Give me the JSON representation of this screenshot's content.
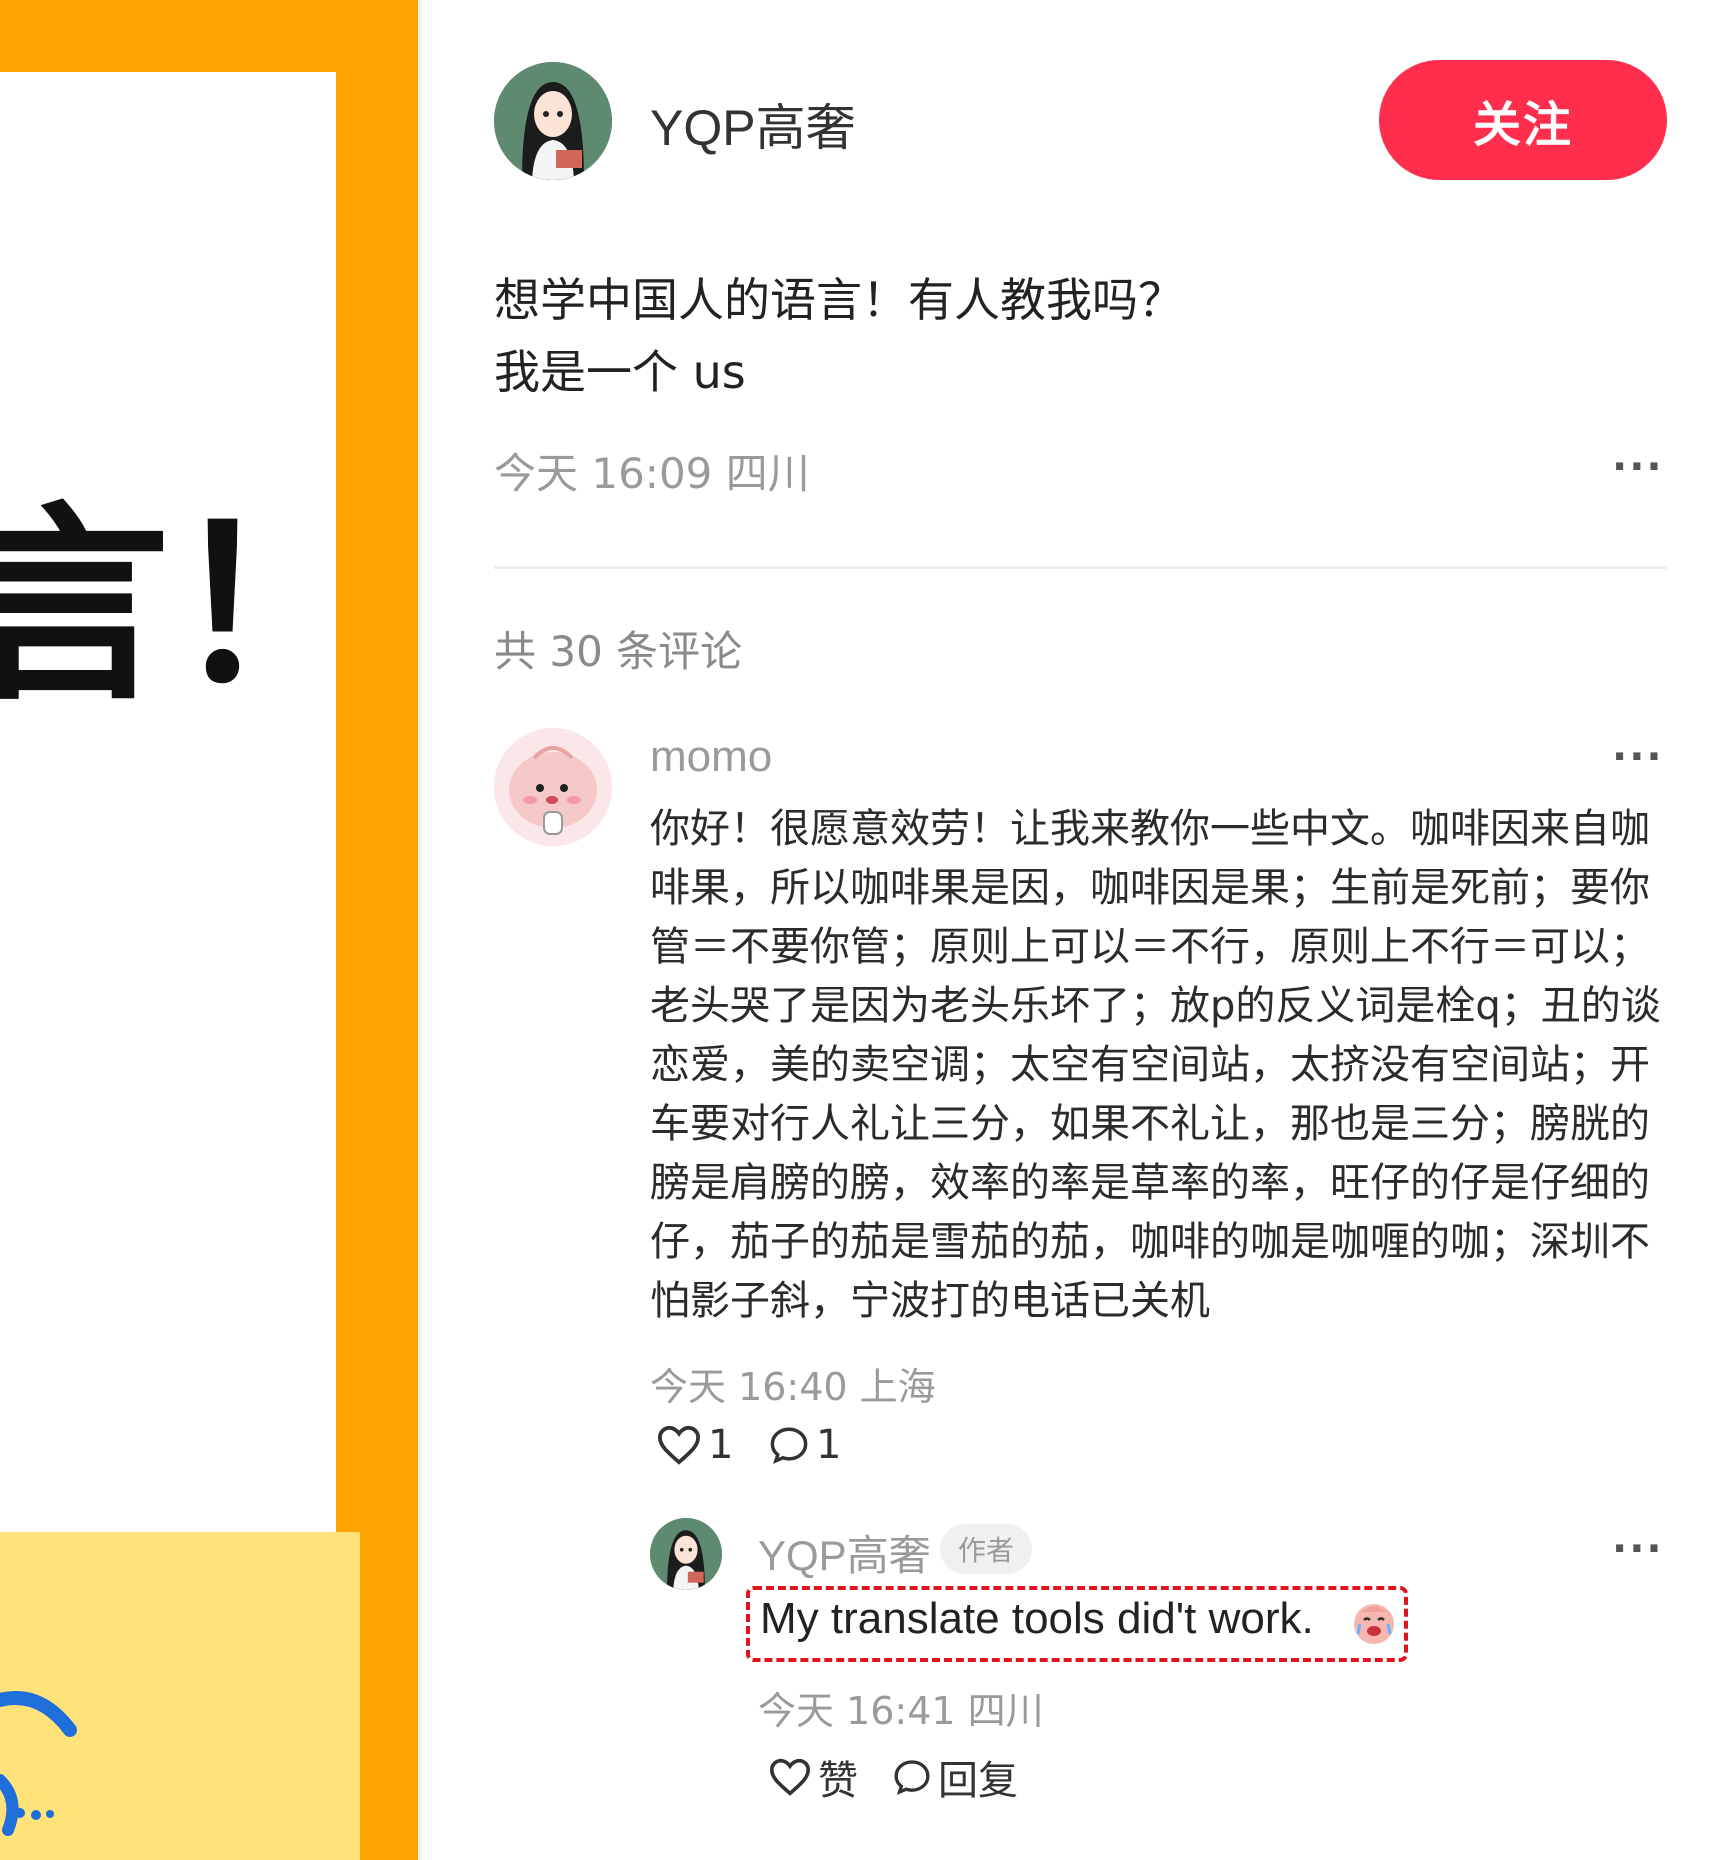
{
  "left_image": {
    "big_text": "言！"
  },
  "post": {
    "author_name": "YQP高奢",
    "follow_label": "关注",
    "text_line_1": "想学中国人的语言！有人教我吗？",
    "text_line_2": "我是一个 us",
    "meta": "今天 16:09 四川",
    "more": "···"
  },
  "comments": {
    "count_label": "共 30 条评论",
    "items": [
      {
        "user": "momo",
        "more": "···",
        "text": "你好！很愿意效劳！让我来教你一些中文。咖啡因来自咖啡果，所以咖啡果是因，咖啡因是果；生前是死前；要你管＝不要你管；原则上可以＝不行，原则上不行＝可以；老头哭了是因为老头乐坏了；放p的反义词是栓q；丑的谈恋爱，美的卖空调；太空有空间站，太挤没有空间站；开车要对行人礼让三分，如果不礼让，那也是三分；膀胱的膀是肩膀的膀，效率的率是草率的率，旺仔的仔是仔细的仔，茄子的茄是雪茄的茄，咖啡的咖是咖喱的咖；深圳不怕影子斜，宁波打的电话已关机",
        "meta": "今天 16:40 上海",
        "likes": "1",
        "replies": "1"
      }
    ],
    "reply": {
      "user": "YQP高奢",
      "badge": "作者",
      "more": "···",
      "text": "My translate tools did't work.",
      "meta": "今天 16:41 四川",
      "like_label": "赞",
      "reply_label": "回复"
    }
  },
  "colors": {
    "accent": "#FF2E4D",
    "left_panel_bg": "#FFA300",
    "highlight_border": "#e0141e"
  }
}
